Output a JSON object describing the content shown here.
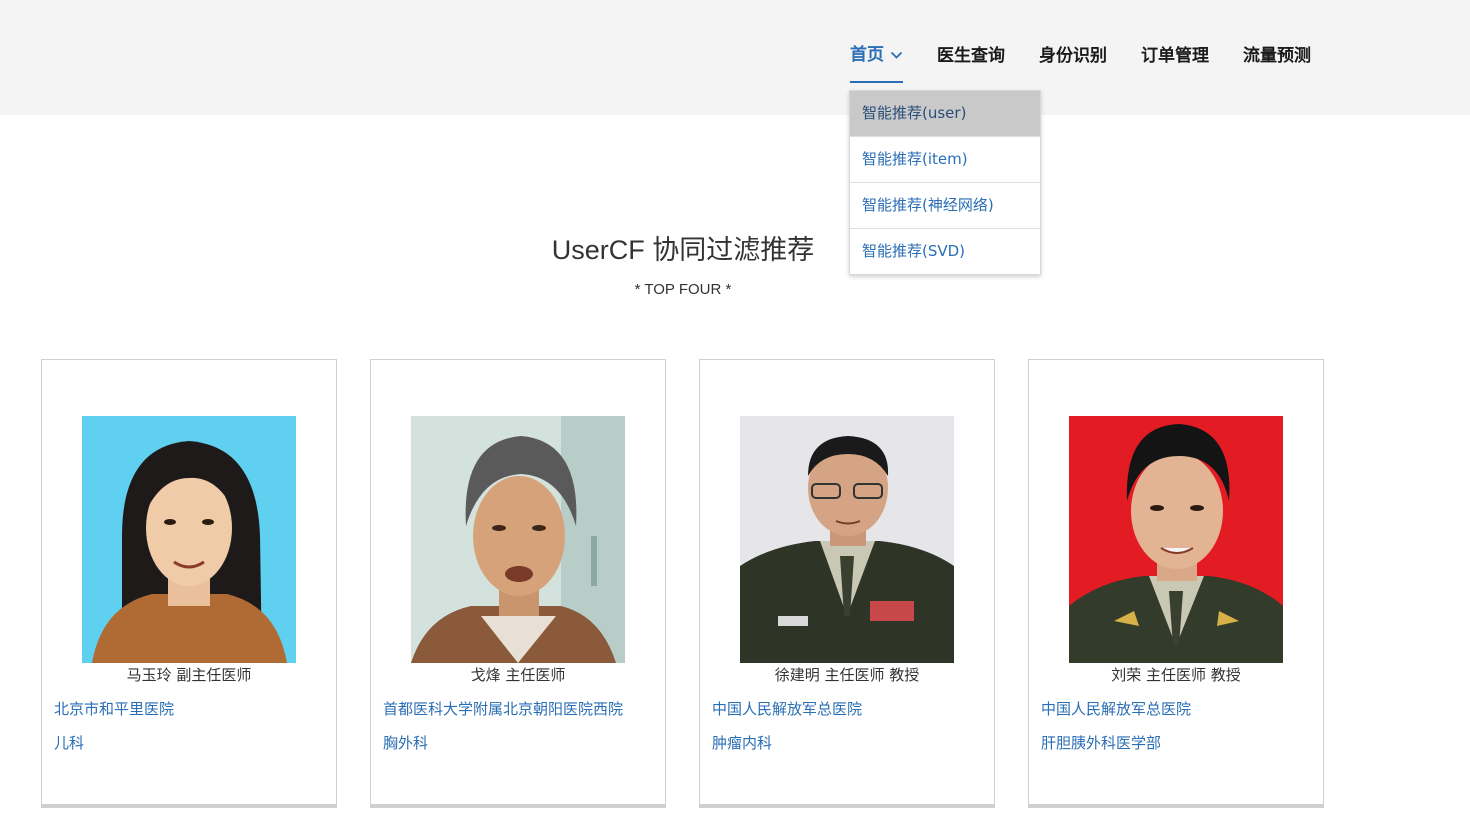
{
  "nav": {
    "items": [
      {
        "label": "首页",
        "active": true
      },
      {
        "label": "医生查询",
        "active": false
      },
      {
        "label": "身份识别",
        "active": false
      },
      {
        "label": "订单管理",
        "active": false
      },
      {
        "label": "流量预测",
        "active": false
      }
    ],
    "dropdown": [
      {
        "label": "智能推荐(user)"
      },
      {
        "label": "智能推荐(item)"
      },
      {
        "label": "智能推荐(神经网络)"
      },
      {
        "label": "智能推荐(SVD)"
      }
    ]
  },
  "section": {
    "title": "UserCF 协同过滤推荐",
    "subtitle": "* TOP FOUR *"
  },
  "doctors": [
    {
      "name": "马玉玲 副主任医师",
      "hospital": "北京市和平里医院",
      "dept": "儿科",
      "photo_bg": "#5fd0ef"
    },
    {
      "name": "戈烽 主任医师",
      "hospital": "首都医科大学附属北京朝阳医院西院",
      "dept": "胸外科",
      "photo_bg": "#c9dcd5"
    },
    {
      "name": "徐建明 主任医师  教授",
      "hospital": "中国人民解放军总医院",
      "dept": "肿瘤内科",
      "photo_bg": "#e8e8ec"
    },
    {
      "name": "刘荣 主任医师  教授",
      "hospital": "中国人民解放军总医院",
      "dept": "肝胆胰外科医学部",
      "photo_bg": "#e31b22"
    }
  ],
  "colors": {
    "accent": "#2a6eb5",
    "header_bg": "#f4f4f4",
    "dropdown_hover": "#c9c9c9"
  },
  "icons": {
    "nav_dropdown": "chevron-down-icon"
  }
}
